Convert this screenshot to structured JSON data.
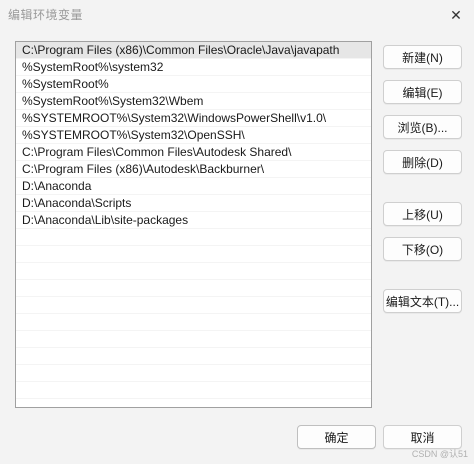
{
  "window": {
    "title": "编辑环境变量"
  },
  "list": {
    "items": [
      "C:\\Program Files (x86)\\Common Files\\Oracle\\Java\\javapath",
      "%SystemRoot%\\system32",
      "%SystemRoot%",
      "%SystemRoot%\\System32\\Wbem",
      "%SYSTEMROOT%\\System32\\WindowsPowerShell\\v1.0\\",
      "%SYSTEMROOT%\\System32\\OpenSSH\\",
      "C:\\Program Files\\Common Files\\Autodesk Shared\\",
      "C:\\Program Files (x86)\\Autodesk\\Backburner\\",
      "D:\\Anaconda",
      "D:\\Anaconda\\Scripts",
      "D:\\Anaconda\\Lib\\site-packages"
    ]
  },
  "buttons": {
    "new": "新建(N)",
    "edit": "编辑(E)",
    "browse": "浏览(B)...",
    "delete": "删除(D)",
    "move_up": "上移(U)",
    "move_down": "下移(O)",
    "edit_text": "编辑文本(T)...",
    "ok": "确定",
    "cancel": "取消"
  },
  "watermark": "CSDN @认51"
}
